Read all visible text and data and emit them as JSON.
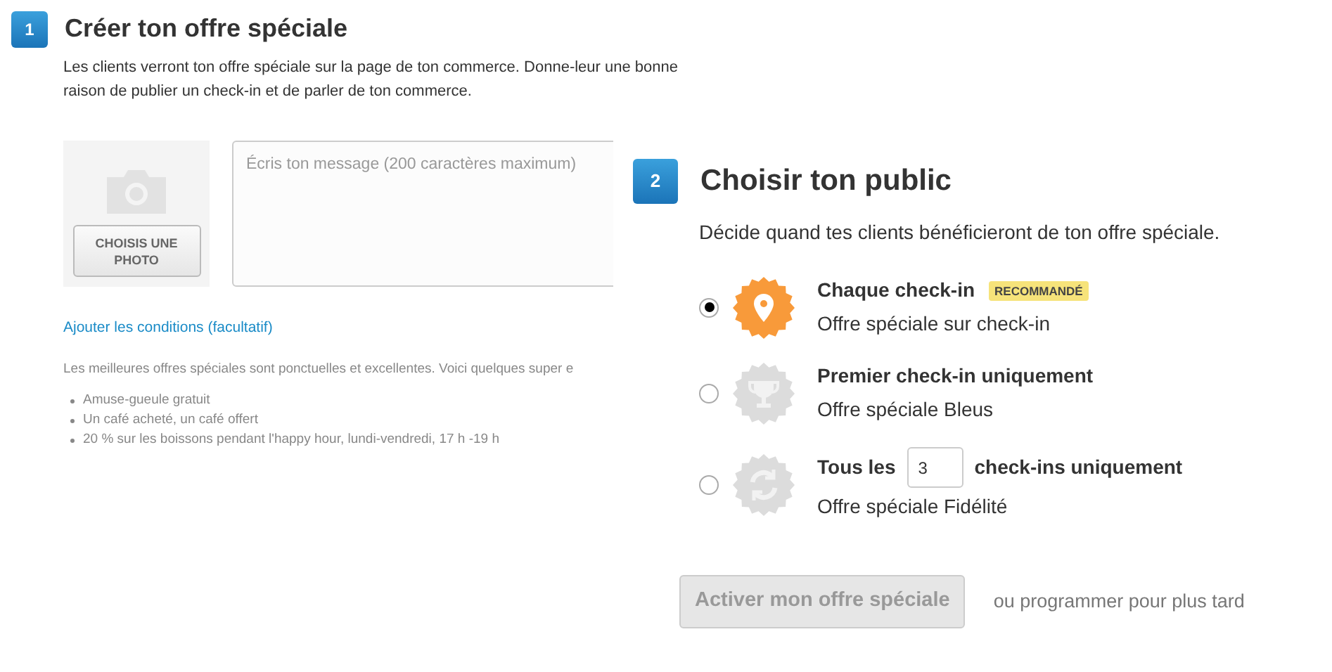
{
  "create_section": {
    "step": "1",
    "title": "Créer ton offre spéciale",
    "description": "Les clients verront ton offre spéciale sur la page de ton commerce. Donne-leur une bonne raison de publier un check-in et de parler de ton commerce.",
    "photo_button": "CHOISIS UNE PHOTO",
    "message_field": {
      "placeholder": "Écris ton message (200 caractères maximum)"
    },
    "conditions_link": "Ajouter les conditions (facultatif)",
    "tips_intro": "Les meilleures offres spéciales sont ponctuelles et excellentes. Voici quelques super e",
    "tips": [
      "Amuse-gueule gratuit",
      "Un café acheté, un café offert",
      "20 % sur les boissons pendant l'happy hour, lundi-vendredi, 17 h -19 h"
    ]
  },
  "audience_section": {
    "step": "2",
    "title": "Choisir ton public",
    "description": "Décide quand tes clients bénéficieront de ton offre spéciale.",
    "options": [
      {
        "kind": "plain",
        "title": "Chaque check-in",
        "badge": "RECOMMANDÉ",
        "subtitle": "Offre spéciale sur check-in",
        "selected": true
      },
      {
        "kind": "plain",
        "title": "Premier check-in uniquement",
        "subtitle": "Offre spéciale Bleus",
        "selected": false
      },
      {
        "kind": "count",
        "title_before": "Tous les",
        "count": "3",
        "title_after": "check-ins uniquement",
        "subtitle": "Offre spéciale Fidélité",
        "selected": false
      }
    ],
    "activate_button": {
      "label": "Activer mon offre spéciale",
      "disabled": true
    },
    "schedule_text": "ou programmer pour plus tard"
  }
}
